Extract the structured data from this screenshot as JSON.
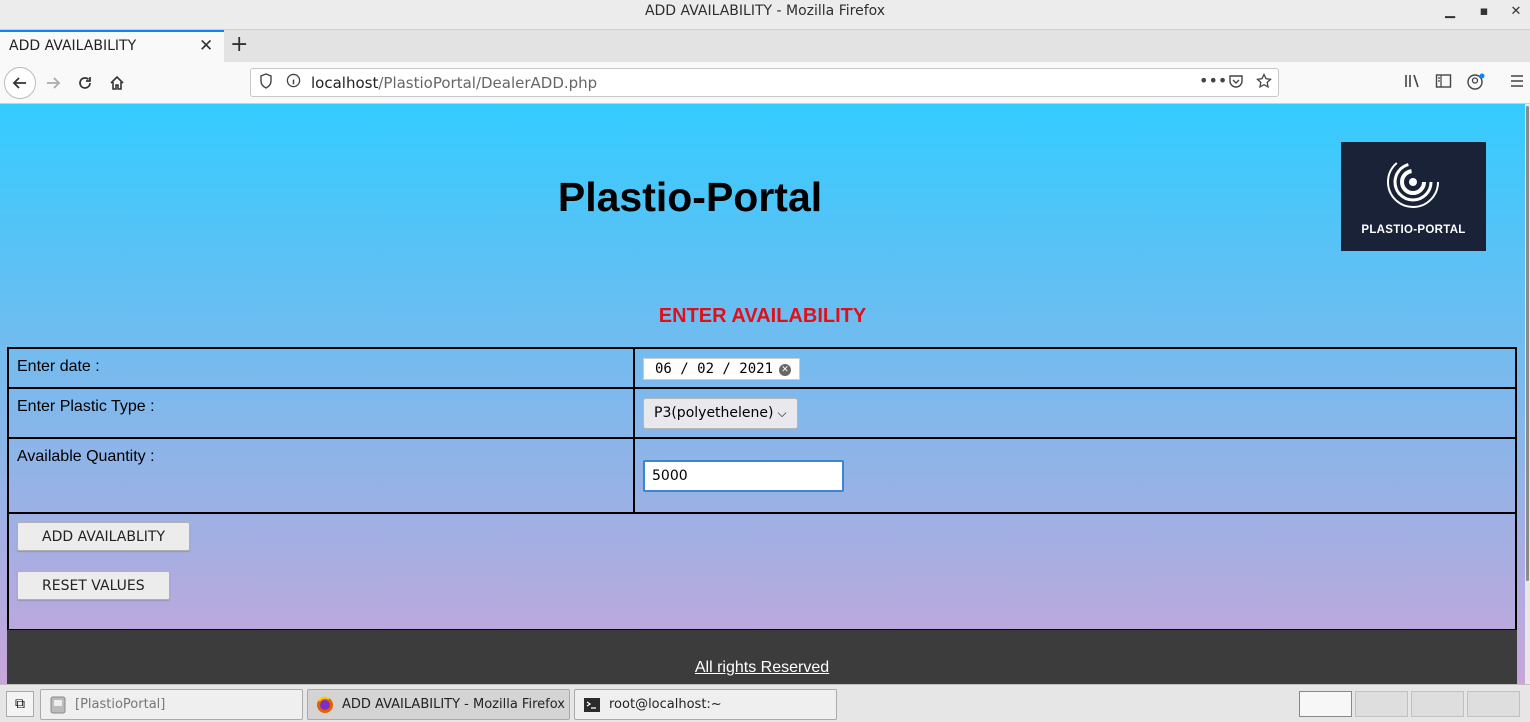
{
  "window": {
    "title": "ADD AVAILABILITY - Mozilla Firefox",
    "controls": {
      "minimize": "▁",
      "maximize": "▪",
      "close": "✕"
    }
  },
  "tab": {
    "label": "ADD AVAILABILITY",
    "close": "✕",
    "new_tab": "+"
  },
  "nav": {
    "back_icon": "back-arrow-icon",
    "forward_icon": "forward-arrow-icon",
    "reload_icon": "reload-icon",
    "home_icon": "home-icon",
    "url_host": "localhost",
    "url_path": "/PlastioPortal/DealerADD.php"
  },
  "page": {
    "site_title": "Plastio-Portal",
    "logo_text": "PLASTIO-PORTAL",
    "heading": "ENTER AVAILABILITY",
    "form": {
      "date_label": "Enter date :",
      "date_value": "06 / 02 / 2021",
      "plastic_label": "Enter Plastic Type :",
      "plastic_value": "P3(polyethelene)",
      "quantity_label": "Available Quantity :",
      "quantity_value": "5000",
      "add_button": "ADD AVAILABLITY",
      "reset_button": "RESET VALUES"
    },
    "footer": "All rights Reserved"
  },
  "taskbar": {
    "items": [
      {
        "label": "[PlastioPortal]",
        "active": false
      },
      {
        "label": "ADD AVAILABILITY - Mozilla Firefox",
        "active": true
      },
      {
        "label": "root@localhost:~",
        "active": false
      }
    ]
  },
  "colors": {
    "page_gradient_top": "#33ccff",
    "page_gradient_bottom": "#c9a5d9",
    "heading": "#e0101a",
    "logo_bg": "#1a2238",
    "footer_bg": "#3c3c3c",
    "tab_accent": "#0a84ff"
  }
}
